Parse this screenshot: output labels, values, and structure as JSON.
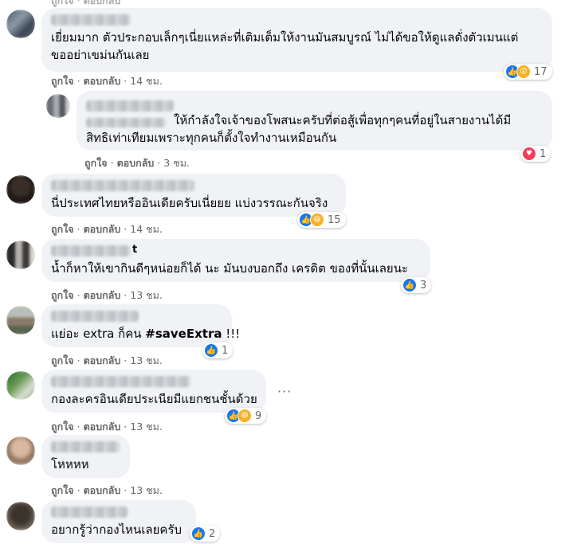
{
  "actions": {
    "like": "ถูกใจ",
    "reply": "ตอบกลับ",
    "sep": "·"
  },
  "comments": [
    {
      "text_lines": [
        "เยี่ยมมาก ตัวประกอบเล็กๆเนี่ยแหล่ะที่เติมเต็มให้งานมันสมบูรณ์ ไม่ได้ขอให้ดูแลดั่งตัวเมนแต่",
        "ขออย่าเขม่นกันเลย"
      ],
      "time": "14 ชม.",
      "reactions": [
        "like",
        "wow"
      ],
      "count": "17"
    },
    {
      "text_lines": [
        "ให้กำลังใจเจ้าของโพสนะครับที่ต่อสู้เพื่อทุกๆคนที่อยู่ในสายงานได้มี",
        "สิทธิเท่าเทียมเพราะทุกคนก็ตั้งใจทำงานเหมือนกัน"
      ],
      "time": "3 ชม.",
      "reactions": [
        "love"
      ],
      "count": "1"
    },
    {
      "text_lines": [
        "นี่ประเทศไทยหรืออินเดียครับเนี่ยยย แบ่งวรรณะกันจริง"
      ],
      "time": "14 ชม.",
      "reactions": [
        "like",
        "haha"
      ],
      "count": "15"
    },
    {
      "name_fragment": "t",
      "text_lines": [
        "น้ำก็หาให้เขากินดีๆหน่อยก็ได้ นะ มันบงบอกถึง เครดิต ของที่นั้นเลยนะ"
      ],
      "time": "13 ชม.",
      "reactions": [
        "like"
      ],
      "count": "3"
    },
    {
      "text_prefix": "แย่อะ extra ก็คน ",
      "text_bold": "#saveExtra",
      "text_suffix": " !!!",
      "time": "13 ชม.",
      "reactions": [
        "like"
      ],
      "count": "1"
    },
    {
      "text_lines": [
        "กองละครอินเดียประเนียมีแยกชนชั้นด้วย"
      ],
      "time": "13 ชม.",
      "reactions": [
        "like",
        "haha"
      ],
      "count": "9",
      "more": "···"
    },
    {
      "text_lines": [
        "โหหหห"
      ],
      "time": "13 ชม."
    },
    {
      "text_lines": [
        "อยากรู้ว่ากองไหนเลยครับ"
      ],
      "reactions": [
        "like"
      ],
      "count": "2"
    }
  ],
  "colors": {
    "bubble": "#f0f2f5",
    "meta": "#65676b",
    "like": "#1877f2",
    "love": "#f33e58",
    "wow": "#f7b125"
  }
}
